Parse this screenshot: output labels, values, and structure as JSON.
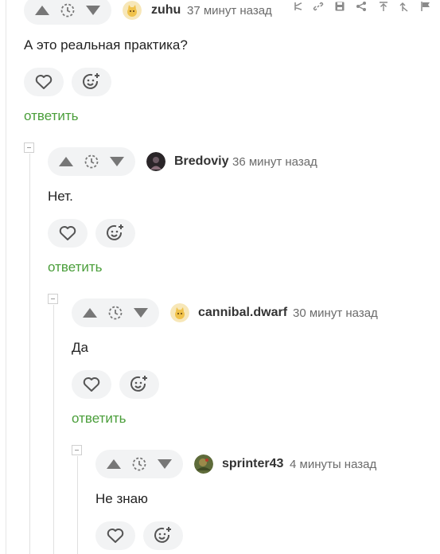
{
  "comments": [
    {
      "username": "zuhu",
      "time": "37 минут назад",
      "text": "А это реальная практика?",
      "reply_label": "ответить",
      "avatar": "cat-cartoon-avatar"
    },
    {
      "username": "Bredoviy",
      "time": "36 минут назад",
      "text": "Нет.",
      "reply_label": "ответить",
      "avatar": "dark-photo-avatar"
    },
    {
      "username": "cannibal.dwarf",
      "time": "30 минут назад",
      "text": "Да",
      "reply_label": "ответить",
      "avatar": "cat-cartoon-avatar"
    },
    {
      "username": "sprinter43",
      "time": "4 минуты назад",
      "text": "Не знаю",
      "avatar": "green-photo-avatar"
    }
  ],
  "icons": {
    "upvote": "arrow-up-icon",
    "downvote": "arrow-down-icon",
    "rating": "clock-dashed-icon",
    "like": "heart-icon",
    "reaction": "smile-plus-icon",
    "tools": [
      "branch-icon",
      "link-icon",
      "save-icon",
      "share-icon",
      "to-top-icon",
      "to-parent-icon",
      "flag-icon"
    ]
  },
  "colors": {
    "reply_link": "#4a9e3a",
    "pill_bg": "#f2f3f4",
    "icon": "#7a7a7a"
  }
}
